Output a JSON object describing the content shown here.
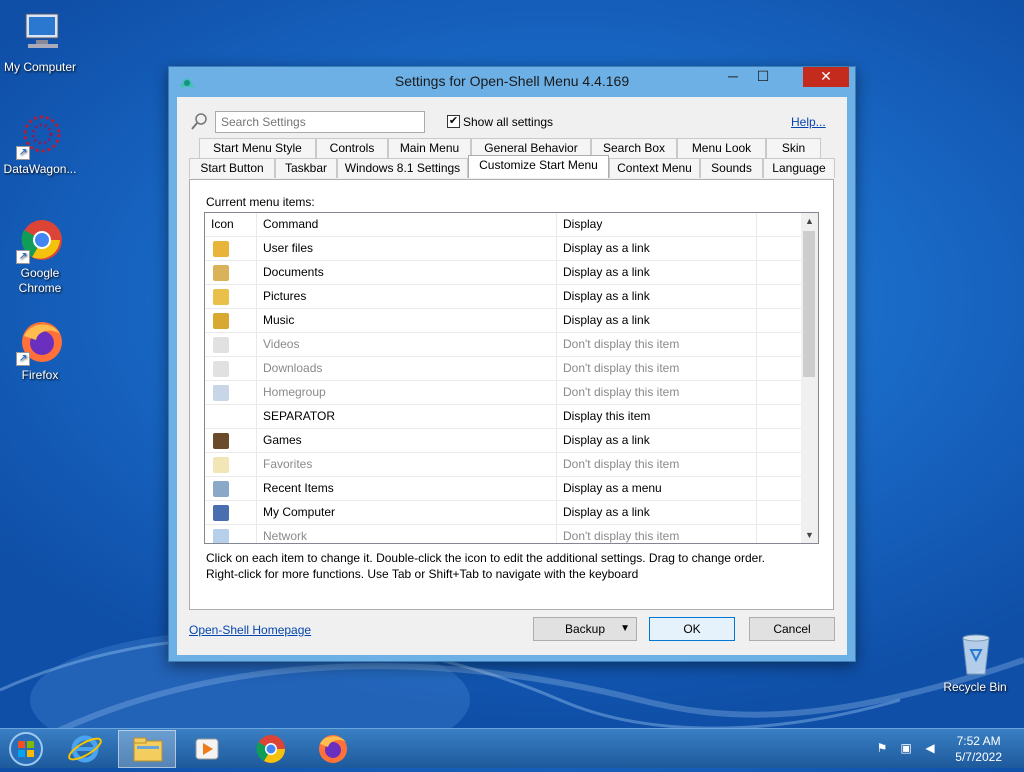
{
  "desktop": {
    "icons": [
      {
        "label": "My Computer",
        "icon": "computer-icon"
      },
      {
        "label": "DataWagon...",
        "icon": "datawagon-icon"
      },
      {
        "label": "Google Chrome",
        "icon": "chrome-icon"
      },
      {
        "label": "Firefox",
        "icon": "firefox-icon"
      },
      {
        "label": "Recycle Bin",
        "icon": "recycle-bin-icon"
      }
    ]
  },
  "window": {
    "title": "Settings for Open-Shell Menu 4.4.169",
    "controls": {
      "minimize": "─",
      "maximize": "☐",
      "close": "✕"
    },
    "search_placeholder": "Search Settings",
    "show_all_label": "Show all settings",
    "show_all_checked": "✔",
    "help_link": "Help...",
    "tabs_row1": [
      "Start Menu Style",
      "Controls",
      "Main Menu",
      "General Behavior",
      "Search Box",
      "Menu Look",
      "Skin"
    ],
    "tabs_row2": [
      "Start Button",
      "Taskbar",
      "Windows 8.1 Settings",
      "Customize Start Menu",
      "Context Menu",
      "Sounds",
      "Language"
    ],
    "active_tab": "Customize Start Menu",
    "panel": {
      "label": "Current menu items:",
      "columns": [
        "Icon",
        "Command",
        "Display"
      ],
      "rows": [
        {
          "command": "User files",
          "display": "Display as a link",
          "dim": false,
          "icon": "user-folder-icon"
        },
        {
          "command": "Documents",
          "display": "Display as a link",
          "dim": false,
          "icon": "documents-folder-icon"
        },
        {
          "command": "Pictures",
          "display": "Display as a link",
          "dim": false,
          "icon": "pictures-folder-icon"
        },
        {
          "command": "Music",
          "display": "Display as a link",
          "dim": false,
          "icon": "music-folder-icon"
        },
        {
          "command": "Videos",
          "display": "Don't display this item",
          "dim": true,
          "icon": "videos-folder-icon"
        },
        {
          "command": "Downloads",
          "display": "Don't display this item",
          "dim": true,
          "icon": "downloads-folder-icon"
        },
        {
          "command": "Homegroup",
          "display": "Don't display this item",
          "dim": true,
          "icon": "homegroup-icon"
        },
        {
          "command": "SEPARATOR",
          "display": "Display this item",
          "dim": false,
          "icon": ""
        },
        {
          "command": "Games",
          "display": "Display as a link",
          "dim": false,
          "icon": "games-icon"
        },
        {
          "command": "Favorites",
          "display": "Don't display this item",
          "dim": true,
          "icon": "favorites-star-icon"
        },
        {
          "command": "Recent Items",
          "display": "Display as a menu",
          "dim": false,
          "icon": "recent-items-icon"
        },
        {
          "command": "My Computer",
          "display": "Display as a link",
          "dim": false,
          "icon": "computer-icon"
        },
        {
          "command": "Network",
          "display": "Don't display this item",
          "dim": true,
          "icon": "network-icon"
        }
      ],
      "hint_line1": "Click on each item to change it. Double-click the icon to edit the additional settings. Drag to change order.",
      "hint_line2": "Right-click for more functions. Use Tab or Shift+Tab to navigate with the keyboard"
    },
    "homepage_link": "Open-Shell Homepage",
    "backup_button": "Backup",
    "ok_button": "OK",
    "cancel_button": "Cancel"
  },
  "taskbar": {
    "items": [
      "start-orb-icon",
      "internet-explorer-icon",
      "file-explorer-icon",
      "media-player-icon",
      "chrome-icon",
      "firefox-icon"
    ],
    "time": "7:52 AM",
    "date": "5/7/2022"
  },
  "colors": {
    "accent": "#0078d7",
    "title_bar": "#6cb0e6",
    "close": "#c42b1c",
    "link": "#0645ad"
  }
}
